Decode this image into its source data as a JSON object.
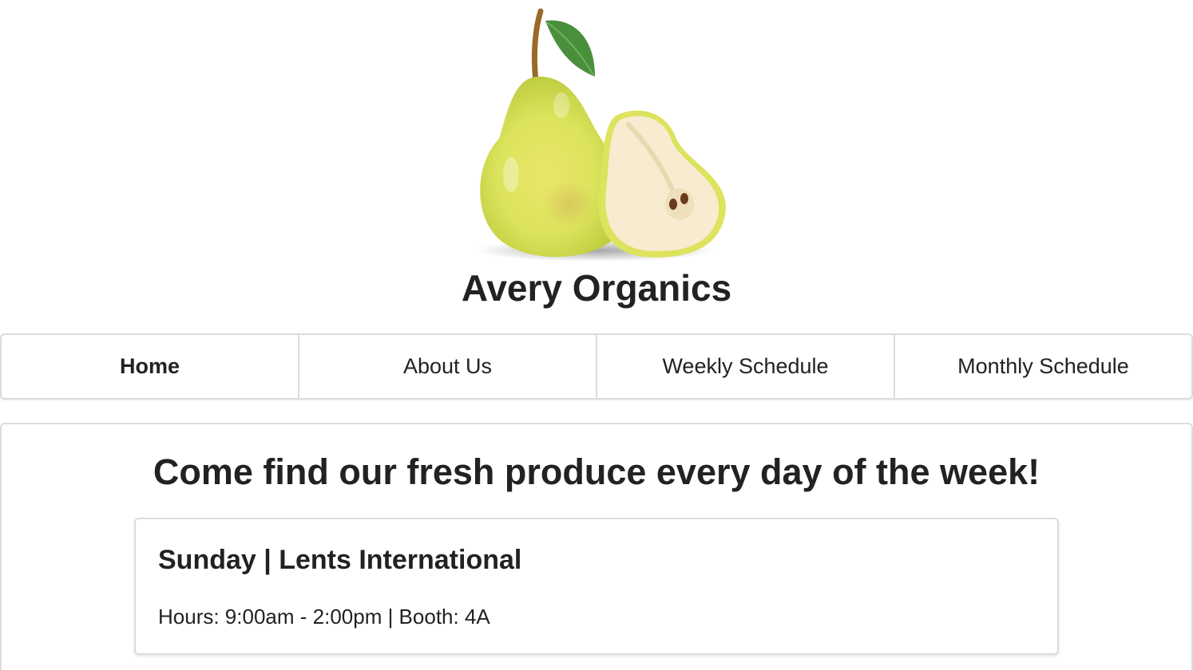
{
  "header": {
    "logo_icon": "pear-icon",
    "site_title": "Avery Organics"
  },
  "nav": {
    "items": [
      {
        "label": "Home",
        "active": true
      },
      {
        "label": "About Us",
        "active": false
      },
      {
        "label": "Weekly Schedule",
        "active": false
      },
      {
        "label": "Monthly Schedule",
        "active": false
      }
    ]
  },
  "main": {
    "headline": "Come find our fresh produce every day of the week!",
    "schedule": [
      {
        "title": "Sunday | Lents International",
        "info": "Hours: 9:00am - 2:00pm | Booth: 4A"
      }
    ]
  },
  "colors": {
    "text": "#222222",
    "border": "#dcdcdc",
    "pear_skin": "#d9e25a",
    "pear_flesh": "#f7ebd0",
    "leaf": "#4a8f3c",
    "stem": "#9a6a2a"
  }
}
